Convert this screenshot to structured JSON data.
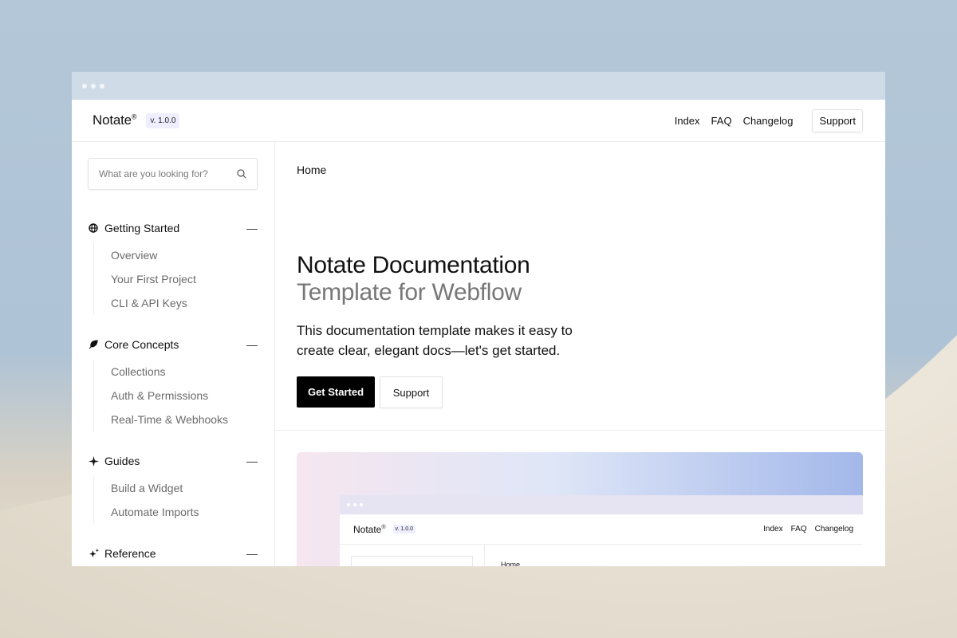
{
  "window": {
    "dots": 3
  },
  "topnav": {
    "logo": "Notate",
    "logo_mark": "®",
    "version": "v. 1.0.0",
    "links": [
      "Index",
      "FAQ",
      "Changelog"
    ],
    "support_label": "Support"
  },
  "search": {
    "placeholder": "What are you looking for?"
  },
  "sidebar": {
    "sections": [
      {
        "title": "Getting Started",
        "icon": "globe-icon",
        "items": [
          "Overview",
          "Your First Project",
          "CLI & API Keys"
        ]
      },
      {
        "title": "Core Concepts",
        "icon": "leaf-icon",
        "items": [
          "Collections",
          "Auth & Permissions",
          "Real-Time & Webhooks"
        ]
      },
      {
        "title": "Guides",
        "icon": "sparkle-icon",
        "items": [
          "Build a Widget",
          "Automate Imports"
        ]
      },
      {
        "title": "Reference",
        "icon": "sparkles-icon",
        "items": []
      }
    ],
    "collapse_symbol": "—"
  },
  "main": {
    "breadcrumb": "Home",
    "title": "Notate Documentation",
    "subtitle": "Template for Webflow",
    "description": "This documentation template makes it easy to create clear, elegant docs—let's get started.",
    "primary_button": "Get Started",
    "secondary_button": "Support"
  },
  "preview": {
    "logo": "Notate",
    "logo_mark": "®",
    "version": "v. 1.0.0",
    "links": [
      "Index",
      "FAQ",
      "Changelog"
    ],
    "breadcrumb": "Home"
  },
  "colors": {
    "accent": "#000000",
    "version_badge_bg": "#eeeeff",
    "window_bar": "#cfdbe6",
    "muted_text": "#6b6b6b"
  }
}
